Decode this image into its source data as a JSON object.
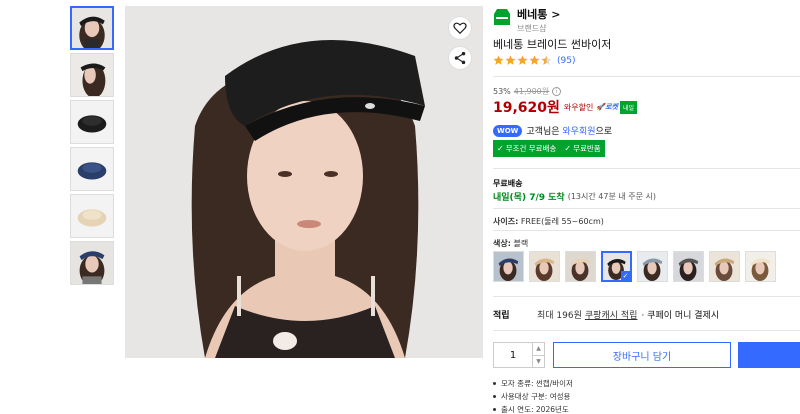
{
  "brand": {
    "name": "베네통 >",
    "subtitle": "브랜드샵"
  },
  "product": {
    "title": "베네통 브레이드 썬바이저",
    "rating": 4.5,
    "review_count": "(95)",
    "discount": "53%",
    "original_price": "41,900원",
    "price": "19,620원",
    "price_label": "와우할인",
    "rocket_label": "로켓",
    "rocket_badge": "내일"
  },
  "wow": {
    "badge": "WOW",
    "text_prefix": "고객님은",
    "link": "와우회원",
    "text_suffix": "으로"
  },
  "shipping_badges": [
    "무조건 무료배송",
    "무료반품"
  ],
  "shipping": {
    "title": "무료배송",
    "date": "내일(목) 7/9 도착",
    "note": "(13시간 47분 내 주문 시)"
  },
  "size": {
    "label": "사이즈:",
    "value": "FREE(둘레 55~60cm)"
  },
  "color": {
    "label": "색상:",
    "value": "블랙",
    "swatch_count": 8,
    "selected_index": 3
  },
  "points": {
    "label": "적립",
    "text": "최대 196원",
    "link": "쿠팡캐시 적립",
    "tail": "· 쿠페이 머니 결제시"
  },
  "quantity": "1",
  "cart_button": "장바구니 담기",
  "specs": [
    "모자 종류: 썬캡/바이저",
    "사용대상 구분: 여성용",
    "출시 연도: 2026년도"
  ],
  "colors": {
    "accent": "#346aff",
    "price": "#ae0000",
    "green": "#00a32e"
  }
}
